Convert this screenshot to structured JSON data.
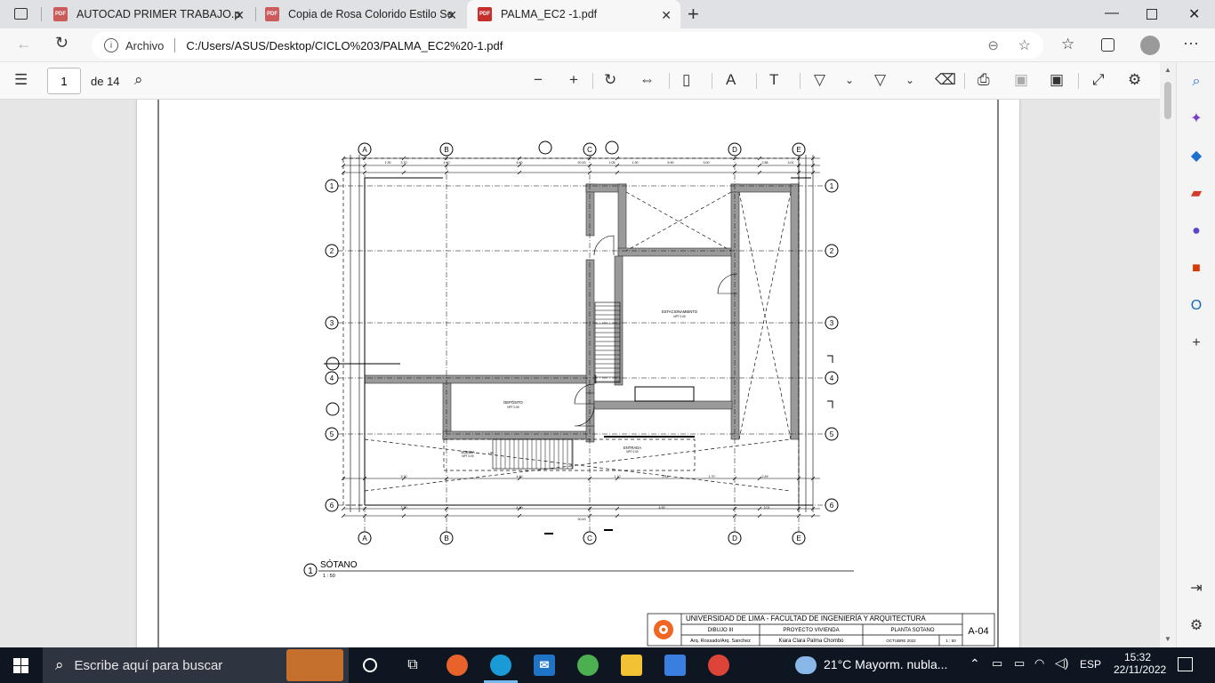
{
  "browser": {
    "tabs": [
      {
        "title": "AUTOCAD PRIMER TRABAJO.pdf",
        "active": false
      },
      {
        "title": "Copia de Rosa Colorido Estilo Se",
        "active": false
      },
      {
        "title": "PALMA_EC2 -1.pdf",
        "active": true
      }
    ],
    "address": {
      "scheme_label": "Archivo",
      "url": "C:/Users/ASUS/Desktop/CICLO%203/PALMA_EC2%20-1.pdf"
    }
  },
  "pdf_toolbar": {
    "page_value": "1",
    "page_total": "de 14"
  },
  "drawing": {
    "grid_cols": [
      "A",
      "B",
      "C",
      "D",
      "E"
    ],
    "grid_rows": [
      "1",
      "2",
      "3",
      "4",
      "5",
      "6"
    ],
    "rooms": {
      "estacionamiento": "ESTACIONAMIENTO",
      "estacionamiento_npt": "NPT 0.00",
      "deposito": "DEPÓSITO",
      "deposito_npt": "NPT 0.00",
      "subida": "SUBIDA",
      "subida_npt": "NPT 0.00",
      "entrada": "ENTRADA",
      "entrada_npt": "NPT 0.00",
      "up": "UP"
    },
    "dims_top": [
      "1.30",
      "3.70",
      "4.40",
      "4.60",
      "20.43",
      "1.05",
      "1.30",
      "6.90",
      "3.00",
      "2.88",
      "3.01"
    ],
    "dims_bottom": [
      "3.70",
      "4.40",
      "4.90",
      "3.01",
      "20.43"
    ],
    "dims_mid_bottom": [
      "3.70",
      "4.40",
      "1.10",
      "2.44",
      "1.70",
      "2.49"
    ],
    "title": "SÓTANO",
    "scale": "1 : 50",
    "view_number": "1"
  },
  "title_block": {
    "university": "UNIVERSIDAD DE LIMA - FACULTAD DE INGENIERÍA Y ARQUITECTURA",
    "course": "DIBUJO III",
    "project": "PROYECTO VIVIENDA",
    "sheet_title": "PLANTA SOTANO",
    "teachers": "Arq. Rossado/Arq. Sanchez",
    "student": "Kiara Clara Palma Chombo",
    "date": "OCTUBRE 2022",
    "scale": "1 : 50",
    "sheet_code": "A-04"
  },
  "taskbar": {
    "search_placeholder": "Escribe aquí para buscar",
    "weather": "21°C  Mayorm. nubla...",
    "language": "ESP",
    "time": "15:32",
    "date": "22/11/2022"
  }
}
